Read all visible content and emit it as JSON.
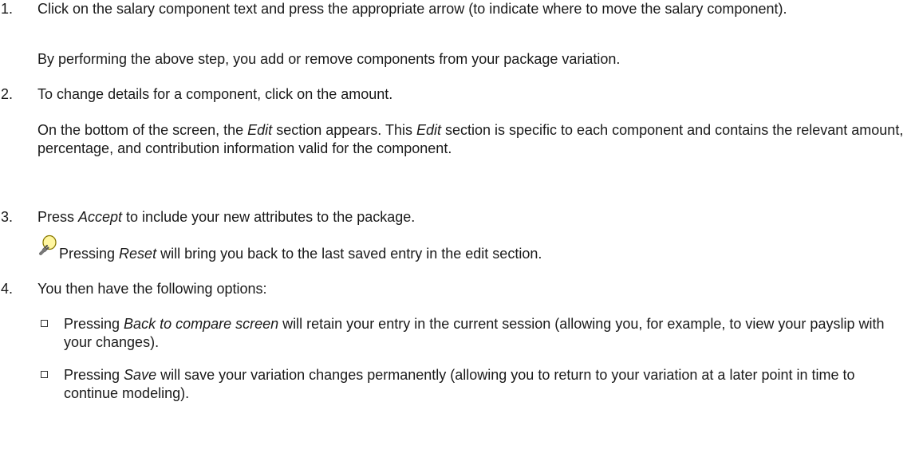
{
  "steps": [
    {
      "num": "1.",
      "text": "Click on the salary component text and press the appropriate arrow (to indicate where to move the salary component).",
      "note": "By performing the above step, you add or remove components from your package variation."
    },
    {
      "num": "2.",
      "text": "To change details for a component, click on the amount.",
      "note_pre1": "On the bottom of the screen, the ",
      "note_em1": "Edit",
      "note_mid1": " section appears. This ",
      "note_em2": "Edit",
      "note_post": " section is specific to each component and contains the relevant amount, percentage, and contribution information valid for the component."
    },
    {
      "num": "3.",
      "pre": "Press ",
      "em": "Accept",
      "post": " to include your new attributes to the package.",
      "tip_pre": "Pressing ",
      "tip_em": "Reset",
      "tip_post": " will bring you back to the last saved entry in the edit section."
    },
    {
      "num": "4.",
      "text": "You then have the following options:",
      "options": [
        {
          "pre": "Pressing ",
          "em": "Back to compare screen",
          "post": " will retain your entry in the current session (allowing you, for example, to view your payslip with your changes)."
        },
        {
          "pre": "Pressing ",
          "em": "Save",
          "post": " will save your variation changes permanently (allowing you to return to your variation at a later point in time to continue modeling)."
        }
      ]
    }
  ],
  "icons": {
    "tip": "lightbulb-icon",
    "bullet": "checkbox-bullet-icon"
  }
}
